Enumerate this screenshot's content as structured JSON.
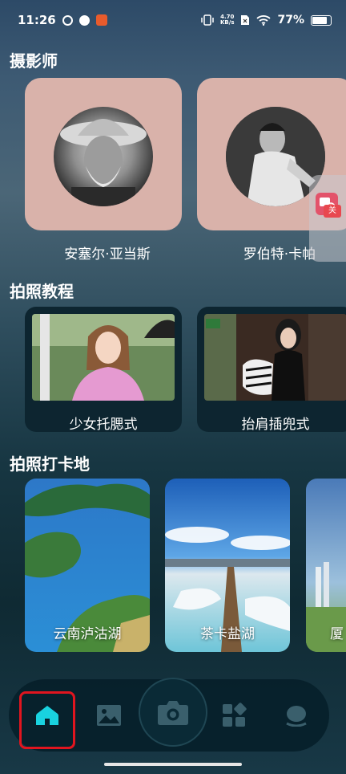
{
  "status_bar": {
    "time": "11:26",
    "net_speed_value": "4.70",
    "net_speed_unit": "KB/s",
    "battery": "77%"
  },
  "sections": {
    "photographers": "摄影师",
    "tutorials": "拍照教程",
    "spots": "拍照打卡地"
  },
  "photographers": [
    {
      "name": "安塞尔·亚当斯"
    },
    {
      "name": "罗伯特·卡帕"
    }
  ],
  "tutorials": [
    {
      "label": "少女托腮式"
    },
    {
      "label": "抬肩插兜式"
    }
  ],
  "spots": [
    {
      "label": "云南泸沽湖"
    },
    {
      "label": "茶卡盐湖"
    },
    {
      "label": "厦"
    }
  ],
  "float_widget": {
    "tag": "关"
  },
  "nav": {
    "items": [
      "home-icon",
      "gallery-icon",
      "camera-icon",
      "apps-icon",
      "profile-icon"
    ],
    "active": "home"
  },
  "colors": {
    "card_pink": "#d9b2aa",
    "accent_cyan": "#19d3e0",
    "highlight_red": "#e0151f"
  }
}
